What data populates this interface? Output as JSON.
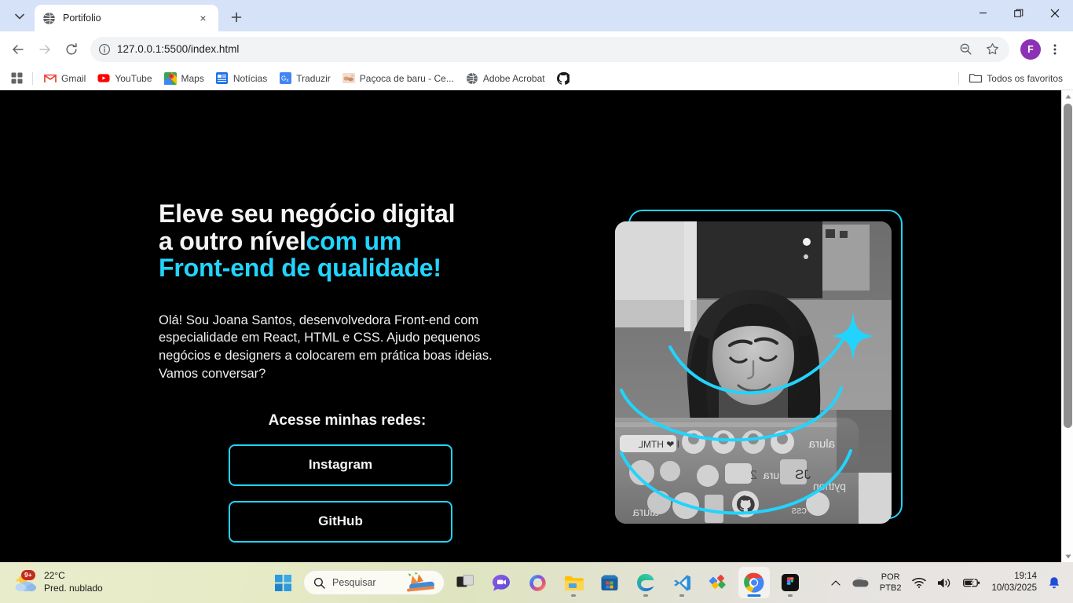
{
  "browser": {
    "tab": {
      "title": "Portifolio",
      "favicon": "globe-icon",
      "close": "×"
    },
    "new_tab_label": "+",
    "window_controls": {
      "minimize": "—",
      "restore": "❐",
      "close": "✕"
    },
    "toolbar": {
      "back": "←",
      "forward": "→",
      "reload": "⟳",
      "site_info": "ⓘ",
      "url": "127.0.0.1:5500/index.html",
      "zoom_icon": "zoom-out-icon",
      "bookmark_icon": "star-icon",
      "avatar_initial": "F",
      "menu_icon": "⋮"
    },
    "bookmarks": {
      "apps_icon": "apps-grid-icon",
      "items": [
        {
          "label": "Gmail",
          "icon": "gmail-icon"
        },
        {
          "label": "YouTube",
          "icon": "youtube-icon"
        },
        {
          "label": "Maps",
          "icon": "maps-icon"
        },
        {
          "label": "Notícias",
          "icon": "news-icon"
        },
        {
          "label": "Traduzir",
          "icon": "translate-icon"
        },
        {
          "label": "Paçoca de baru - Ce...",
          "icon": "image-icon"
        },
        {
          "label": "Adobe Acrobat",
          "icon": "globe-icon"
        },
        {
          "label": "",
          "icon": "github-icon"
        }
      ],
      "all_bookmarks": {
        "label": "Todos os favoritos",
        "icon": "folder-icon"
      }
    }
  },
  "page": {
    "headline": {
      "line1": "Eleve seu negócio digital",
      "line2_plain": "a outro nível",
      "line2_accent": "com um",
      "line3_accent": "Front-end de qualidade!"
    },
    "bio": "Olá! Sou Joana Santos, desenvolvedora Front-end com especialidade em React, HTML e CSS. Ajudo pequenos negócios e designers a colocarem em prática boas ideias. Vamos conversar?",
    "redes_title": "Acesse minhas redes:",
    "buttons": [
      {
        "label": "Instagram"
      },
      {
        "label": "GitHub"
      }
    ],
    "photo": {
      "alt": "Desenvolvedora sorrindo em frente a um notebook coberto de adesivos",
      "decorations": [
        "sparkle-icon",
        "arc-top",
        "arc-middle",
        "arc-bottom"
      ]
    },
    "colors": {
      "accent": "#22D4FD",
      "background": "#000000",
      "text": "#F5F5F5"
    }
  },
  "taskbar": {
    "weather": {
      "temperature": "22°C",
      "condition": "Pred. nublado",
      "badge": "9+"
    },
    "start_icon": "windows-start-icon",
    "search": {
      "placeholder": "Pesquisar",
      "icon": "search-icon"
    },
    "apps": [
      {
        "name": "task-view",
        "icon": "task-view-icon",
        "running": false
      },
      {
        "name": "chat",
        "icon": "chat-icon",
        "running": false
      },
      {
        "name": "copilot",
        "icon": "copilot-icon",
        "running": false
      },
      {
        "name": "file-explorer",
        "icon": "folder-icon",
        "running": true
      },
      {
        "name": "microsoft-store",
        "icon": "store-icon",
        "running": false
      },
      {
        "name": "microsoft-edge",
        "icon": "edge-icon",
        "running": true
      },
      {
        "name": "vs-code",
        "icon": "vscode-icon",
        "running": true
      },
      {
        "name": "app-diamond",
        "icon": "diamond-icon",
        "running": false
      },
      {
        "name": "google-chrome",
        "icon": "chrome-icon",
        "running": true,
        "active": true
      },
      {
        "name": "figma",
        "icon": "figma-icon",
        "running": true
      }
    ],
    "tray": {
      "overflow": "˄",
      "cloud_icon": "cloud-icon",
      "language_line1": "POR",
      "language_line2": "PTB2",
      "wifi_icon": "wifi-icon",
      "volume_icon": "speaker-icon",
      "battery_icon": "battery-icon",
      "time": "19:14",
      "date": "10/03/2025",
      "notification_icon": "bell-icon"
    }
  }
}
